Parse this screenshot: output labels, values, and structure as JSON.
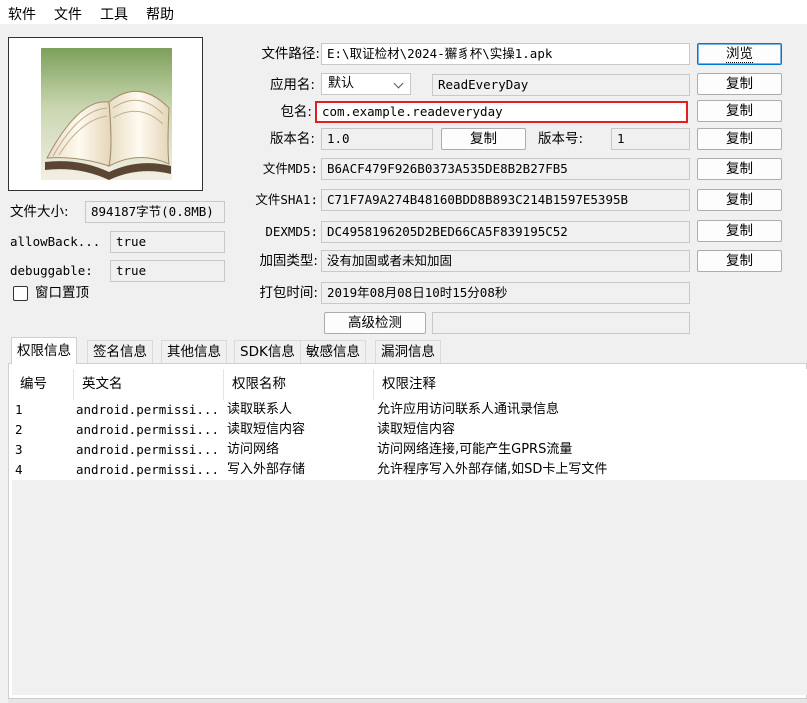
{
  "menu": [
    "软件",
    "文件",
    "工具",
    "帮助"
  ],
  "left": {
    "file_size_label": "文件大小:",
    "file_size_value": "894187字节(0.8MB)",
    "allow_backup_label": "allowBack...",
    "allow_backup_value": "true",
    "debuggable_label": "debuggable:",
    "debuggable_value": "true",
    "always_on_top_label": "窗口置顶"
  },
  "form": {
    "file_path_label": "文件路径:",
    "file_path_value": "E:\\取证检材\\2024-獬豸杯\\实操1.apk",
    "browse_button": "浏览",
    "app_name_label": "应用名:",
    "app_name_lang": "默认",
    "app_name_value": "ReadEveryDay",
    "package_label": "包名:",
    "package_value": "com.example.readeveryday",
    "version_name_label": "版本名:",
    "version_name_value": "1.0",
    "version_code_label": "版本号:",
    "version_code_value": "1",
    "md5_label": "文件MD5:",
    "md5_value": "B6ACF479F926B0373A535DE8B2B27FB5",
    "sha1_label": "文件SHA1:",
    "sha1_value": "C71F7A9A274B48160BDD8B893C214B1597E5395B",
    "dexmd5_label": "DEXMD5:",
    "dexmd5_value": "DC4958196205D2BED66CA5F839195C52",
    "packer_label": "加固类型:",
    "packer_value": "没有加固或者未知加固",
    "pack_time_label": "打包时间:",
    "pack_time_value": "2019年08月08日10时15分08秒",
    "advanced_button": "高级检测",
    "copy_button": "复制"
  },
  "tabs": [
    "权限信息",
    "签名信息",
    "其他信息",
    "SDK信息",
    "敏感信息",
    "漏洞信息"
  ],
  "table": {
    "headers": [
      "编号",
      "英文名",
      "权限名称",
      "权限注释"
    ],
    "rows": [
      [
        "1",
        "android.permissi...",
        "读取联系人",
        "允许应用访问联系人通讯录信息"
      ],
      [
        "2",
        "android.permissi...",
        "读取短信内容",
        "读取短信内容"
      ],
      [
        "3",
        "android.permissi...",
        "访问网络",
        "访问网络连接,可能产生GPRS流量"
      ],
      [
        "4",
        "android.permissi...",
        "写入外部存储",
        "允许程序写入外部存储,如SD卡上写文件"
      ]
    ]
  },
  "colors": {
    "highlight_border": "#e02020",
    "focus_border": "#0078d7"
  },
  "icons": {
    "app_icon": "open-book-image"
  }
}
